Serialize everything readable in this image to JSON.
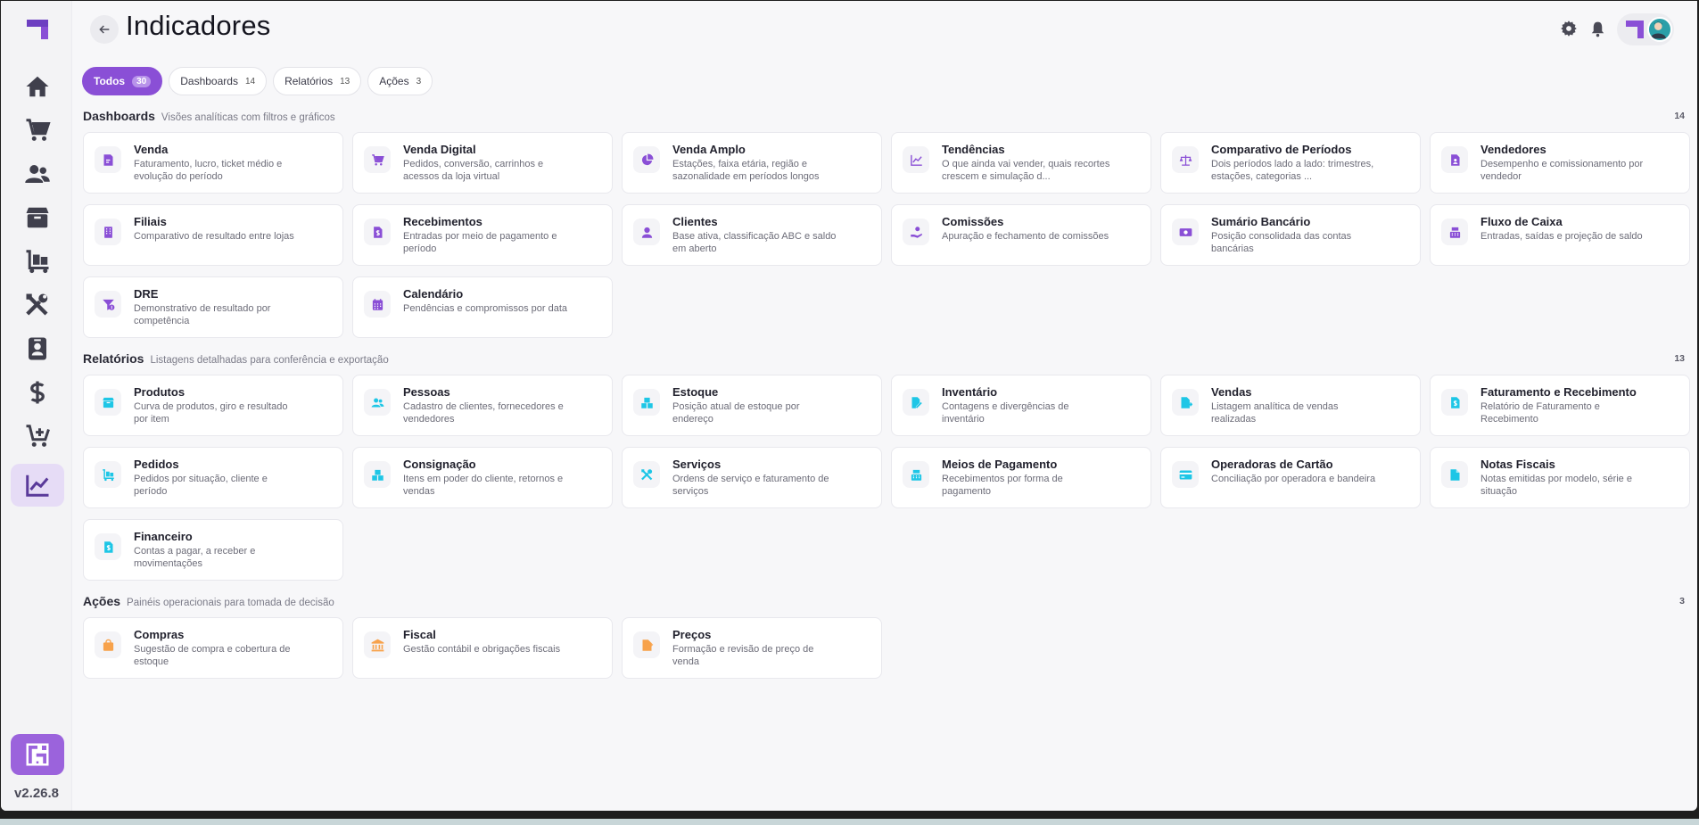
{
  "app": {
    "version": "v2.26.8",
    "page_title": "Indicadores",
    "colors": {
      "accent": "#8a4fd6",
      "dash_icon": "#8a4fd6",
      "rel_icon": "#1ec6e6",
      "acao_icon": "#f7a24b"
    }
  },
  "sidebar": {
    "items": [
      {
        "icon": "home-icon"
      },
      {
        "icon": "cart-icon"
      },
      {
        "icon": "people-icon"
      },
      {
        "icon": "box-icon"
      },
      {
        "icon": "dolly-icon"
      },
      {
        "icon": "tools-icon"
      },
      {
        "icon": "badge-icon"
      },
      {
        "icon": "dollar-icon"
      },
      {
        "icon": "cart-plus-icon"
      },
      {
        "icon": "chart-line-icon",
        "active": true
      }
    ]
  },
  "tabs": [
    {
      "label": "Todos",
      "count": "30",
      "active": true
    },
    {
      "label": "Dashboards",
      "count": "14"
    },
    {
      "label": "Relatórios",
      "count": "13"
    },
    {
      "label": "Ações",
      "count": "3"
    }
  ],
  "sections": {
    "dashboards": {
      "title": "Dashboards",
      "desc": "Visões analíticas com filtros e gráficos",
      "count": "14",
      "cards": [
        {
          "title": "Venda",
          "desc": "Faturamento, lucro, ticket médio e evolução do período",
          "icon": "receipt-icon"
        },
        {
          "title": "Venda Digital",
          "desc": "Pedidos, conversão, carrinhos e acessos da loja virtual",
          "icon": "cart-icon"
        },
        {
          "title": "Venda Amplo",
          "desc": "Estações, faixa etária, região e sazonalidade em períodos longos",
          "icon": "pie-chart-icon"
        },
        {
          "title": "Tendências",
          "desc": "O que ainda vai vender, quais recortes crescem e simulação d...",
          "icon": "trend-icon"
        },
        {
          "title": "Comparativo de Períodos",
          "desc": "Dois períodos lado a lado: trimestres, estações, categorias ...",
          "icon": "scale-icon"
        },
        {
          "title": "Vendedores",
          "desc": "Desempenho e comissionamento por vendedor",
          "icon": "doc-person-icon"
        },
        {
          "title": "Filiais",
          "desc": "Comparativo de resultado entre lojas",
          "icon": "building-icon"
        },
        {
          "title": "Recebimentos",
          "desc": "Entradas por meio de pagamento e período",
          "icon": "doc-dollar-icon"
        },
        {
          "title": "Clientes",
          "desc": "Base ativa, classificação ABC e saldo em aberto",
          "icon": "person-icon"
        },
        {
          "title": "Comissões",
          "desc": "Apuração e fechamento de comissões",
          "icon": "hand-coin-icon"
        },
        {
          "title": "Sumário Bancário",
          "desc": "Posição consolidada das contas bancárias",
          "icon": "money-icon"
        },
        {
          "title": "Fluxo de Caixa",
          "desc": "Entradas, saídas e projeção de saldo",
          "icon": "cash-register-icon"
        },
        {
          "title": "DRE",
          "desc": "Demonstrativo de resultado por competência",
          "icon": "funnel-dollar-icon"
        },
        {
          "title": "Calendário",
          "desc": "Pendências e compromissos por data",
          "icon": "calendar-icon"
        }
      ]
    },
    "relatorios": {
      "title": "Relatórios",
      "desc": "Listagens detalhadas para conferência e exportação",
      "count": "13",
      "cards": [
        {
          "title": "Produtos",
          "desc": "Curva de produtos, giro e resultado por item",
          "icon": "box-icon"
        },
        {
          "title": "Pessoas",
          "desc": "Cadastro de clientes, fornecedores e vendedores",
          "icon": "people-icon"
        },
        {
          "title": "Estoque",
          "desc": "Posição atual de estoque por endereço",
          "icon": "boxes-icon"
        },
        {
          "title": "Inventário",
          "desc": "Contagens e divergências de inventário",
          "icon": "doc-edit-icon"
        },
        {
          "title": "Vendas",
          "desc": "Listagem analítica de vendas realizadas",
          "icon": "doc-arrow-icon"
        },
        {
          "title": "Faturamento e Recebimento",
          "desc": "Relatório de Faturamento e Recebimento",
          "icon": "doc-dollar-icon"
        },
        {
          "title": "Pedidos",
          "desc": "Pedidos por situação, cliente e período",
          "icon": "dolly-icon"
        },
        {
          "title": "Consignação",
          "desc": "Itens em poder do cliente, retornos e vendas",
          "icon": "boxes-icon"
        },
        {
          "title": "Serviços",
          "desc": "Ordens de serviço e faturamento de serviços",
          "icon": "tools-icon"
        },
        {
          "title": "Meios de Pagamento",
          "desc": "Recebimentos por forma de pagamento",
          "icon": "cash-register-icon"
        },
        {
          "title": "Operadoras de Cartão",
          "desc": "Conciliação por operadora e bandeira",
          "icon": "credit-card-icon"
        },
        {
          "title": "Notas Fiscais",
          "desc": "Notas emitidas por modelo, série e situação",
          "icon": "doc-icon"
        },
        {
          "title": "Financeiro",
          "desc": "Contas a pagar, a receber e movimentações",
          "icon": "doc-dollar-icon"
        }
      ]
    },
    "acoes": {
      "title": "Ações",
      "desc": "Painéis operacionais para tomada de decisão",
      "count": "3",
      "cards": [
        {
          "title": "Compras",
          "desc": "Sugestão de compra e cobertura de estoque",
          "icon": "bag-icon"
        },
        {
          "title": "Fiscal",
          "desc": "Gestão contábil e obrigações fiscais",
          "icon": "bank-icon"
        },
        {
          "title": "Preços",
          "desc": "Formação e revisão de preço de venda",
          "icon": "price-tag-icon"
        }
      ]
    }
  }
}
